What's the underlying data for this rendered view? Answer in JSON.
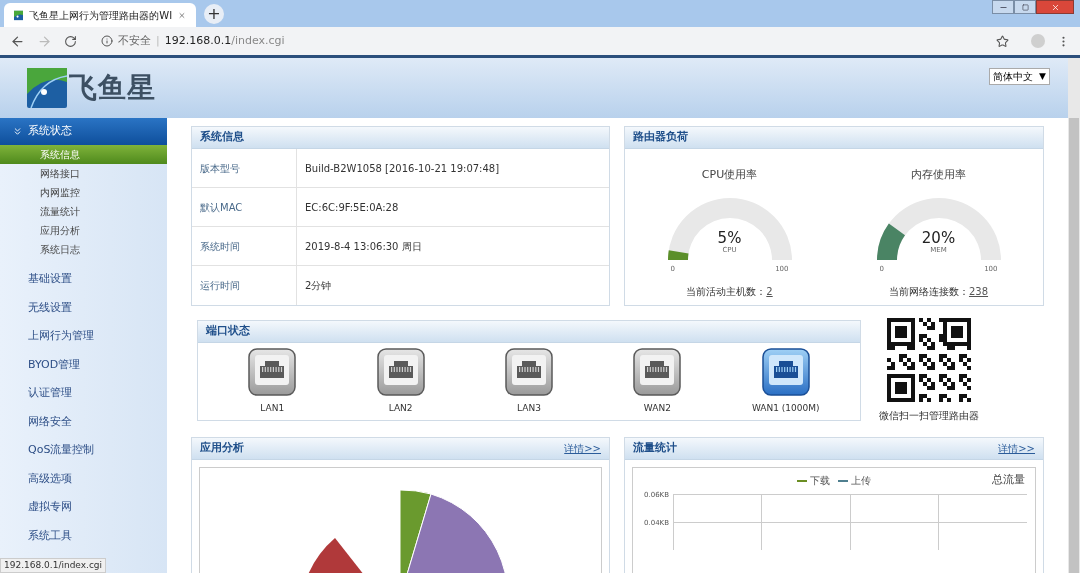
{
  "browser": {
    "tab_title": "飞鱼星上网行为管理路由器的WI",
    "new_tab": "+",
    "address": {
      "security": "不安全",
      "separator": "|",
      "host": "192.168.0.1",
      "path": "/index.cgi"
    }
  },
  "header": {
    "logo_text": "飞鱼星",
    "language": "简体中文",
    "language_arrow": "▼"
  },
  "sidebar": {
    "sections": [
      {
        "label": "系统状态",
        "expanded": true,
        "children": [
          {
            "label": "系统信息",
            "selected": true
          },
          {
            "label": "网络接口",
            "selected": false
          },
          {
            "label": "内网监控",
            "selected": false
          },
          {
            "label": "流量统计",
            "selected": false
          },
          {
            "label": "应用分析",
            "selected": false
          },
          {
            "label": "系统日志",
            "selected": false
          }
        ]
      },
      {
        "label": "基础设置",
        "expanded": false
      },
      {
        "label": "无线设置",
        "expanded": false
      },
      {
        "label": "上网行为管理",
        "expanded": false
      },
      {
        "label": "BYOD管理",
        "expanded": false
      },
      {
        "label": "认证管理",
        "expanded": false
      },
      {
        "label": "网络安全",
        "expanded": false
      },
      {
        "label": "QoS流量控制",
        "expanded": false
      },
      {
        "label": "高级选项",
        "expanded": false
      },
      {
        "label": "虚拟专网",
        "expanded": false
      },
      {
        "label": "系统工具",
        "expanded": false
      }
    ]
  },
  "system_info": {
    "title": "系统信息",
    "rows": [
      {
        "label": "版本型号",
        "value": "Build-B2W1058 [2016-10-21 19:07:48]"
      },
      {
        "label": "默认MAC",
        "value": "EC:6C:9F:5E:0A:28"
      },
      {
        "label": "系统时间",
        "value": "2019-8-4 13:06:30 周日"
      },
      {
        "label": "运行时间",
        "value": "2分钟"
      }
    ]
  },
  "router_load": {
    "title": "路由器负荷",
    "gauges": [
      {
        "title": "CPU使用率",
        "reading": "5%",
        "unit": "CPU",
        "min": "0",
        "max": "100",
        "color": "#5b8f2a",
        "footer_label": "当前活动主机数：",
        "footer_value": "2"
      },
      {
        "title": "内存使用率",
        "reading": "20%",
        "unit": "MEM",
        "min": "0",
        "max": "100",
        "color": "#4a8464",
        "footer_label": "当前网络连接数：",
        "footer_value": "238"
      }
    ]
  },
  "ports": {
    "title": "端口状态",
    "items": [
      {
        "label": "LAN1",
        "connected": false
      },
      {
        "label": "LAN2",
        "connected": false
      },
      {
        "label": "LAN3",
        "connected": false
      },
      {
        "label": "WAN2",
        "connected": false
      },
      {
        "label": "WAN1 (1000M)",
        "connected": true
      }
    ]
  },
  "qr": {
    "caption": "微信扫一扫管理路由器"
  },
  "app_analysis": {
    "title": "应用分析",
    "link": "详情>>"
  },
  "traffic": {
    "title": "流量统计",
    "link": "详情>>",
    "legend": [
      {
        "label": "下载",
        "color": "#6b8e23"
      },
      {
        "label": "上传",
        "color": "#4f7f8f"
      }
    ],
    "chart_title": "总流量",
    "y_labels": [
      "0.06KB",
      "0.04KB"
    ]
  },
  "status_bar": "192.168.0.1/index.cgi"
}
